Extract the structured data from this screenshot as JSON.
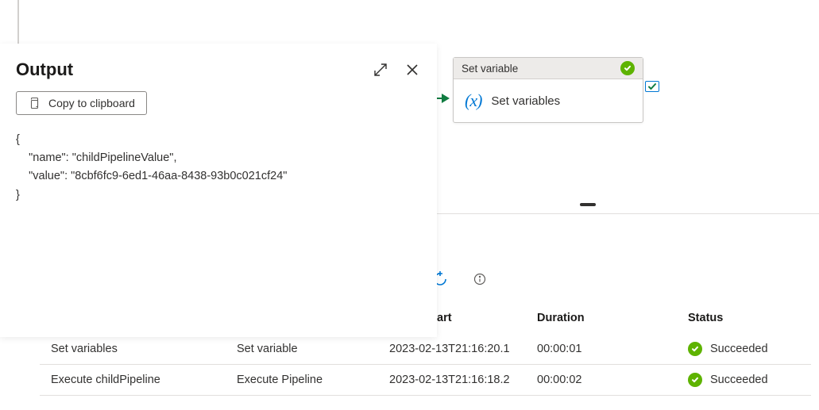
{
  "output": {
    "title": "Output",
    "copy_label": "Copy to clipboard",
    "json_text": "{\n    \"name\": \"childPipelineValue\",\n    \"value\": \"8cbf6fc9-6ed1-46aa-8438-93b0c021cf24\"\n}"
  },
  "activity": {
    "header_label": "Set variable",
    "body_label": "Set variables"
  },
  "table": {
    "headers": {
      "start": "art",
      "duration": "Duration",
      "status": "Status"
    },
    "rows": [
      {
        "name": "Set variables",
        "type": "Set variable",
        "start": "2023-02-13T21:16:20.1",
        "duration": "00:00:01",
        "status": "Succeeded"
      },
      {
        "name": "Execute childPipeline",
        "type": "Execute Pipeline",
        "start": "2023-02-13T21:16:18.2",
        "duration": "00:00:02",
        "status": "Succeeded"
      }
    ]
  }
}
